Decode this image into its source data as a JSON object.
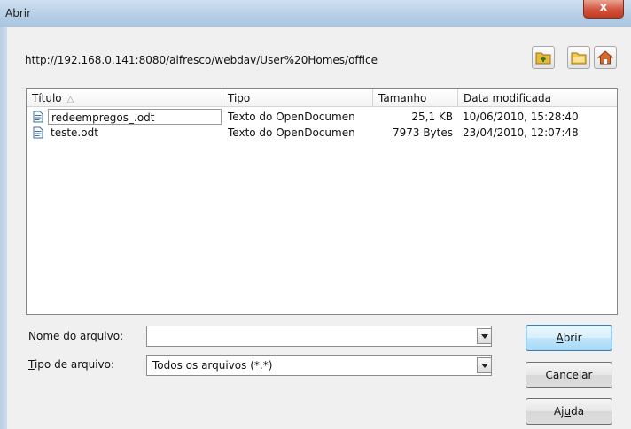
{
  "window": {
    "title": "Abrir",
    "close_glyph": "x"
  },
  "toolbar": {
    "path": "http://192.168.0.141:8080/alfresco/webdav/User%20Homes/office",
    "buttons": [
      {
        "icon": "up-folder-icon"
      },
      {
        "icon": "new-folder-icon"
      },
      {
        "icon": "home-icon"
      }
    ]
  },
  "filelist": {
    "columns": [
      "Título",
      "Tipo",
      "Tamanho",
      "Data modificada"
    ],
    "sort_indicator": "△",
    "rows": [
      {
        "name": "redeempregos_.odt",
        "type": "Texto do OpenDocumen",
        "size": "25,1 KB",
        "date": "10/06/2010, 15:28:40"
      },
      {
        "name": "teste.odt",
        "type": "Texto do OpenDocumen",
        "size": "7973 Bytes",
        "date": "23/04/2010, 12:07:48"
      }
    ]
  },
  "form": {
    "filename_label_first": "N",
    "filename_label_rest": "ome do arquivo:",
    "filename_value": "",
    "filetype_label_first": "T",
    "filetype_label_rest": "ipo de arquivo:",
    "filetype_value": "Todos os arquivos (*.*)"
  },
  "buttons": {
    "open_first": "A",
    "open_rest": "brir",
    "cancel": "Cancelar",
    "help_pre": "Aj",
    "help_u": "u",
    "help_post": "da"
  },
  "colors": {
    "accent": "#3c7fb1",
    "folder": "#e8b93a",
    "close": "#c23a22"
  }
}
